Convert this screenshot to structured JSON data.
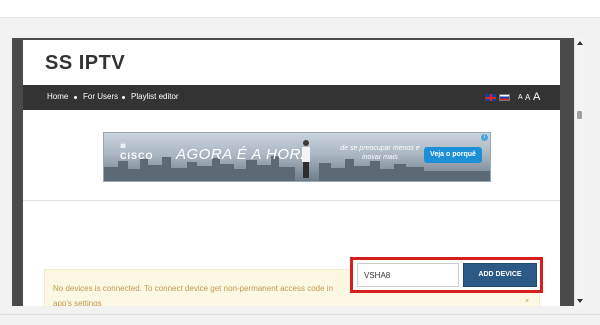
{
  "site": {
    "logo": "SS IPTV"
  },
  "nav": {
    "items": [
      {
        "label": "Home"
      },
      {
        "label": "For Users"
      },
      {
        "label": "Playlist editor"
      }
    ],
    "languages": [
      "english-flag-icon",
      "russian-flag-icon"
    ],
    "font_sizes": [
      "A",
      "A",
      "A"
    ]
  },
  "ad": {
    "brand": "CISCO",
    "headline": "AGORA É A HORA",
    "tagline": "de se preocupar menos e inovar mais",
    "cta": "Veja o porquê",
    "adchoices": "i",
    "colors": {
      "cta": "#1d8fd6"
    }
  },
  "device": {
    "code_value": "VSHA8",
    "add_button": "ADD DEVICE",
    "colors": {
      "highlight_border": "#d81d1d",
      "button": "#2a5a85"
    }
  },
  "alert": {
    "message": "No devices is connected. To connect device get non-permanent access code in app's settings",
    "close": "×"
  }
}
